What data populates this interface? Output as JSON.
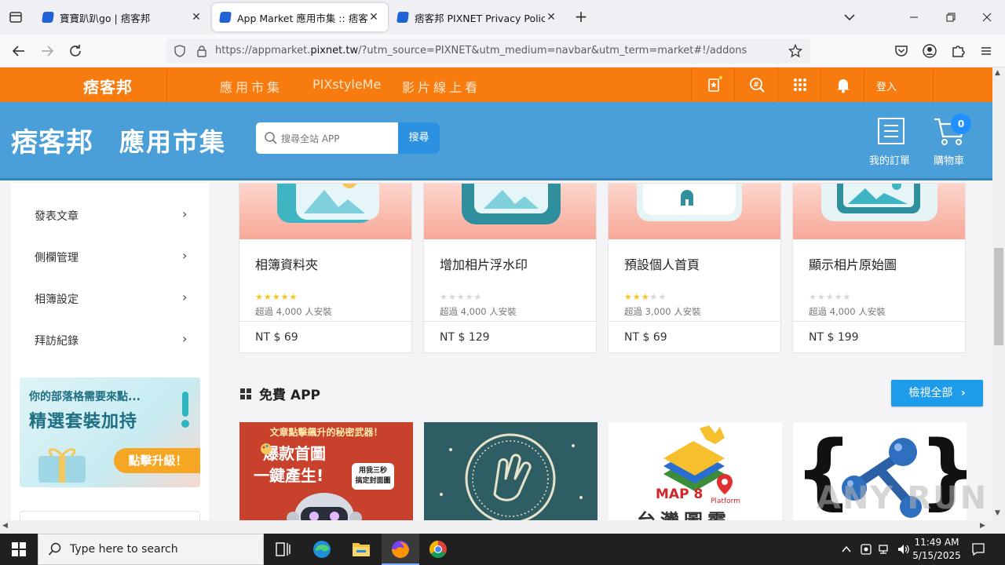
{
  "browser": {
    "tabs": [
      {
        "title": "寶寶趴趴go | 痞客邦",
        "active": false
      },
      {
        "title": "App Market 應用市集 :: 痞客邦",
        "active": true
      },
      {
        "title": "痞客邦 PIXNET Privacy Policy",
        "active": false
      }
    ],
    "close_glyph": "✕",
    "newtab_glyph": "+",
    "url_prefix": "https://appmarket.",
    "url_domain": "pixnet.tw",
    "url_suffix": "/?utm_source=PIXNET&utm_medium=navbar&utm_term=market#!/addons"
  },
  "pixbar": {
    "logo": "痞客邦",
    "menu": [
      "應用市集",
      "PIXstyleMe",
      "影片線上看"
    ],
    "login": "登入"
  },
  "header": {
    "brand": "痞客邦",
    "brand_sub": "應用市集",
    "search_placeholder": "搜尋全站 APP",
    "search_button": "搜尋",
    "orders_label": "我的訂單",
    "cart_label": "購物車",
    "cart_count": "0"
  },
  "sidebar": {
    "items": [
      {
        "label": "發表文章"
      },
      {
        "label": "側欄管理"
      },
      {
        "label": "相簿設定"
      },
      {
        "label": "拜訪紀錄"
      }
    ],
    "arrow": "›",
    "promo": {
      "line1": "你的部落格需要來點...",
      "line2": "精選套裝加持",
      "cta": "點擊升級！"
    }
  },
  "paid_apps": [
    {
      "name": "相簿資料夾",
      "rating": 5,
      "installs": "超過 4,000 人安裝",
      "price": "NT $ 69",
      "icon": "photo-icon"
    },
    {
      "name": "增加相片浮水印",
      "rating": 0,
      "installs": "超過 4,000 人安裝",
      "price": "NT $ 129",
      "icon": "photo-icon"
    },
    {
      "name": "預設個人首頁",
      "rating": 3,
      "installs": "超過 3,000 人安裝",
      "price": "NT $ 69",
      "icon": "home-icon"
    },
    {
      "name": "顯示相片原始圖",
      "rating": 0,
      "installs": "超過 4,000 人安裝",
      "price": "NT $ 199",
      "icon": "photo-icon"
    }
  ],
  "free_section": {
    "title": "免費 APP",
    "view_all": "檢視全部",
    "apps": [
      {
        "line1": "文章點擊飆升的秘密武器！",
        "line2": "爆款首圖",
        "line3": "一鍵產生!",
        "badge_line1": "用我三秒",
        "badge_line2": "搞定封面圖",
        "color": "#c8412c"
      },
      {
        "color": "#2e5e63"
      },
      {
        "logo": "MAP 8",
        "logo_sub": "Platform",
        "caption": "台灣圖霸",
        "color": "#ffffff"
      },
      {
        "color": "#ffffff"
      }
    ]
  },
  "taskbar": {
    "search_placeholder": "Type here to search",
    "time": "11:49 AM",
    "date": "5/15/2025"
  },
  "watermark": "ANY RUN",
  "colors": {
    "pixnet_orange": "#f77b0e",
    "header_blue": "#4a9fd8",
    "button_blue": "#1e9be9",
    "star_gold": "#f5c518"
  }
}
